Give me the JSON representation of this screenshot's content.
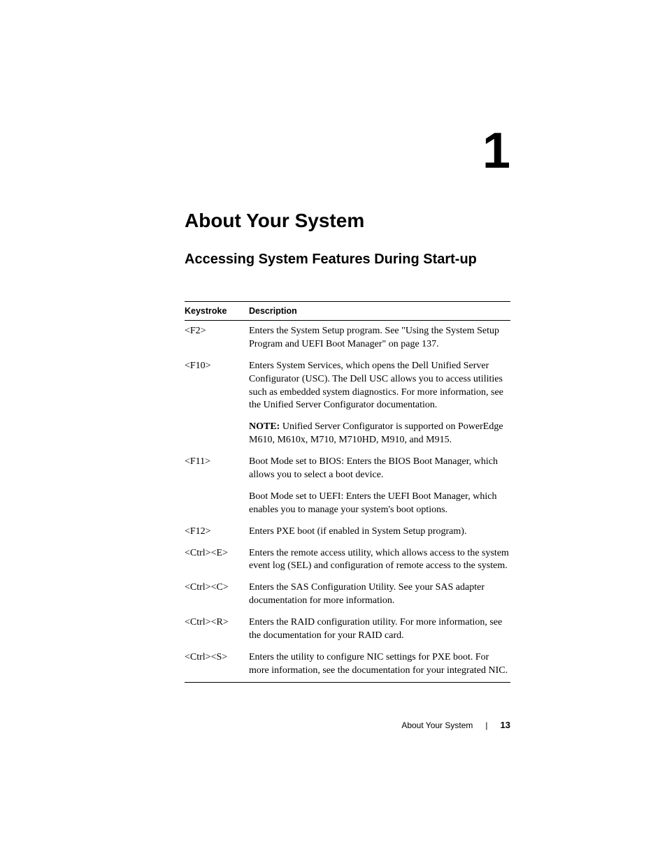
{
  "chapter": {
    "number": "1",
    "title": "About Your System"
  },
  "section": {
    "title": "Accessing System Features During Start-up"
  },
  "table": {
    "headers": {
      "keystroke": "Keystroke",
      "description": "Description"
    },
    "rows": [
      {
        "keystroke": "<F2>",
        "description": "Enters the System Setup program. See \"Using the System Setup Program and UEFI Boot Manager\" on page 137."
      },
      {
        "keystroke": "<F10>",
        "description": "Enters System Services, which opens the Dell Unified Server Configurator (USC). The Dell USC allows you to access utilities such as embedded system diagnostics. For more information, see the Unified Server Configurator documentation.",
        "note_label": "NOTE:",
        "note_text": " Unified Server Configurator is supported on PowerEdge M610, M610x, M710, M710HD, M910, and M915."
      },
      {
        "keystroke": "<F11>",
        "description": "Boot Mode set to BIOS: Enters the BIOS Boot Manager, which allows you to select a boot device.",
        "description2": "Boot Mode set to UEFI: Enters the UEFI Boot Manager, which enables you to manage your system's boot options."
      },
      {
        "keystroke": "<F12>",
        "description": "Enters PXE boot (if enabled in System Setup program)."
      },
      {
        "keystroke": "<Ctrl><E>",
        "description": "Enters the remote access utility, which allows access to the system event log (SEL) and configuration of remote access to the system."
      },
      {
        "keystroke": "<Ctrl><C>",
        "description": "Enters the SAS Configuration Utility. See your SAS adapter documentation for more information."
      },
      {
        "keystroke": "<Ctrl><R>",
        "description": "Enters the RAID configuration utility. For more information, see the documentation for your RAID card."
      },
      {
        "keystroke": "<Ctrl><S>",
        "description": "Enters the utility to configure NIC settings for PXE boot. For more information, see the documentation for your integrated NIC."
      }
    ]
  },
  "footer": {
    "label": "About Your System",
    "page": "13"
  }
}
